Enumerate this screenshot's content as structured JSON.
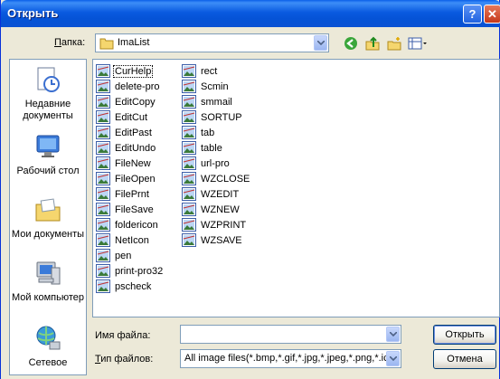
{
  "window": {
    "title": "Открыть",
    "help_button": "?",
    "close_button": "✕"
  },
  "lookin": {
    "label_accel": "П",
    "label_rest": "апка:",
    "value": "ImaList"
  },
  "toolbar_icons": [
    "back-icon",
    "up-folder-icon",
    "new-folder-icon",
    "view-menu-icon"
  ],
  "places": [
    {
      "label": "Недавние документы",
      "icon": "recent-documents-icon"
    },
    {
      "label": "Рабочий стол",
      "icon": "desktop-icon"
    },
    {
      "label": "Мои документы",
      "icon": "my-documents-icon"
    },
    {
      "label": "Мой компьютер",
      "icon": "my-computer-icon"
    },
    {
      "label": "Сетевое",
      "icon": "network-icon"
    }
  ],
  "files_col1": [
    "CurHelp",
    "delete-pro",
    "EditCopy",
    "EditCut",
    "EditPast",
    "EditUndo",
    "FileNew",
    "FileOpen",
    "FilePrnt",
    "FileSave",
    "foldericon",
    "NetIcon",
    "pen",
    "print-pro32",
    "pscheck"
  ],
  "files_col2": [
    "rect",
    "Scmin",
    "smmail",
    "SORTUP",
    "tab",
    "table",
    "url-pro",
    "WZCLOSE",
    "WZEDIT",
    "WZNEW",
    "WZPRINT",
    "WZSAVE"
  ],
  "selected_file": "CurHelp",
  "filename": {
    "label": "Имя файла:",
    "value": ""
  },
  "filetype": {
    "label_accel": "Т",
    "label_rest": "ип файлов:",
    "value": "All image files(*.bmp,*.gif,*.jpg,*.jpeg,*.png,*.ico)"
  },
  "buttons": {
    "open": "Открыть",
    "cancel": "Отмена"
  },
  "colors": {
    "title_bar": "#0a5ae0",
    "dialog_bg": "#ece9d8",
    "field_border": "#7f9db9"
  }
}
